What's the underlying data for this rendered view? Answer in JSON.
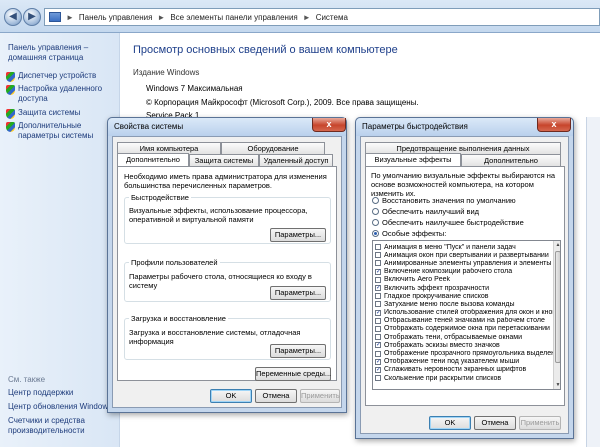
{
  "explorer": {
    "address_parts": [
      "Панель управления",
      "Все элементы панели управления",
      "Система"
    ],
    "address_sep": "►"
  },
  "sidebar": {
    "home": "Панель управления – домашняя страница",
    "items": [
      {
        "label": "Диспетчер устройств",
        "icon": "shield-icon"
      },
      {
        "label": "Настройка удаленного доступа",
        "icon": "shield-icon"
      },
      {
        "label": "Защита системы",
        "icon": "shield-icon"
      },
      {
        "label": "Дополнительные параметры системы",
        "icon": "shield-icon"
      }
    ],
    "see_also": "См. также",
    "links": [
      "Центр поддержки",
      "Центр обновления Windows",
      "Счетчики и средства производительности"
    ]
  },
  "main": {
    "title": "Просмотр основных сведений о вашем компьютере",
    "section": "Издание Windows",
    "edition": "Windows 7 Максимальная",
    "copyright": "© Корпорация Майкрософт (Microsoft Corp.), 2009. Все права защищены.",
    "service_pack": "Service Pack 1"
  },
  "sysprops": {
    "title": "Свойства системы",
    "close": "x",
    "tabs_row1": [
      "Имя компьютера",
      "Оборудование"
    ],
    "tabs_row2": [
      "Дополнительно",
      "Защита системы",
      "Удаленный доступ"
    ],
    "admin_note": "Необходимо иметь права администратора для изменения большинства перечисленных параметров.",
    "perf_group": "Быстродействие",
    "perf_text": "Визуальные эффекты, использование процессора, оперативной и виртуальной памяти",
    "profiles_group": "Профили пользователей",
    "profiles_text": "Параметры рабочего стола, относящиеся ко входу в систему",
    "startup_group": "Загрузка и восстановление",
    "startup_text": "Загрузка и восстановление системы, отладочная информация",
    "params_btn": "Параметры...",
    "env_btn": "Переменные среды...",
    "ok": "OK",
    "cancel": "Отмена",
    "apply": "Применить"
  },
  "perfopts": {
    "title": "Параметры быстродействия",
    "close": "x",
    "tabs_row1": [
      "Предотвращение выполнения данных"
    ],
    "tabs_row2": [
      "Визуальные эффекты",
      "Дополнительно"
    ],
    "intro": "По умолчанию визуальные эффекты выбираются на основе возможностей компьютера, на котором изменить их.",
    "radios": [
      {
        "label": "Восстановить значения по умолчанию",
        "checked": false
      },
      {
        "label": "Обеспечить наилучший вид",
        "checked": false
      },
      {
        "label": "Обеспечить наилучшее быстродействие",
        "checked": false
      },
      {
        "label": "Особые эффекты:",
        "checked": true
      }
    ],
    "effects": [
      {
        "label": "Анимация в меню \"Пуск\" и панели задач",
        "checked": false
      },
      {
        "label": "Анимация окон при свертывании и развертывании",
        "checked": false
      },
      {
        "label": "Анимированные элементы управления и элементы внут",
        "checked": false
      },
      {
        "label": "Включение композиции рабочего стола",
        "checked": true
      },
      {
        "label": "Включить Aero Peek",
        "checked": false
      },
      {
        "label": "Включить эффект прозрачности",
        "checked": true
      },
      {
        "label": "Гладкое прокручивание списков",
        "checked": false
      },
      {
        "label": "Затухание меню после вызова команды",
        "checked": false
      },
      {
        "label": "Использование стилей отображения для окон и кнопок",
        "checked": true
      },
      {
        "label": "Отбрасывание теней значками на рабочем столе",
        "checked": false
      },
      {
        "label": "Отображать содержимое окна при перетаскивании",
        "checked": false
      },
      {
        "label": "Отображать тени, отбрасываемые окнами",
        "checked": false
      },
      {
        "label": "Отображать эскизы вместо значков",
        "checked": true
      },
      {
        "label": "Отображение прозрачного прямоугольника выделени",
        "checked": false
      },
      {
        "label": "Отображение тени под указателем мыши",
        "checked": true
      },
      {
        "label": "Сглаживать неровности экранных шрифтов",
        "checked": true
      },
      {
        "label": "Скольжение при раскрытии списков",
        "checked": false
      }
    ],
    "check_glyph": "✓",
    "ok": "OK",
    "cancel": "Отмена",
    "apply": "Применить"
  }
}
